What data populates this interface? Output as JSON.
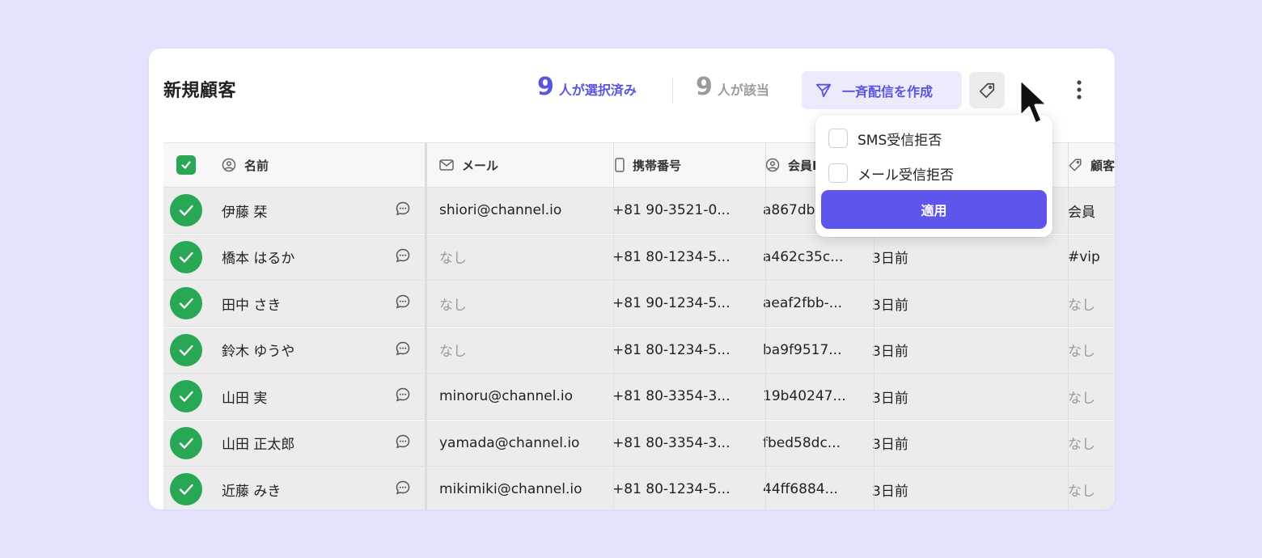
{
  "panel": {
    "title": "新規顧客",
    "selected_count": "9",
    "selected_label": "人が選択済み",
    "matched_count": "9",
    "matched_label": "人が該当",
    "broadcast_label": "一斉配信を作成"
  },
  "colors": {
    "accent": "#5e55ec",
    "check_green": "#28a754",
    "background": "#e3e3fd"
  },
  "columns": [
    "名前",
    "メール",
    "携帯番号",
    "会員I",
    "顧客"
  ],
  "rows": [
    {
      "name": "伊藤 栞",
      "email": "shiori@channel.io",
      "phone": "+81 90-3521-0...",
      "member_id": "a867db",
      "last": "",
      "tag": "会員"
    },
    {
      "name": "橋本 はるか",
      "email": "なし",
      "phone": "+81 80-1234-5...",
      "member_id": "a462c35c...",
      "last": "3日前",
      "tag": "#vip"
    },
    {
      "name": "田中 さき",
      "email": "なし",
      "phone": "+81 90-1234-5...",
      "member_id": "aeaf2fbb-...",
      "last": "3日前",
      "tag": "なし"
    },
    {
      "name": "鈴木 ゆうや",
      "email": "なし",
      "phone": "+81 80-1234-5...",
      "member_id": "ba9f9517...",
      "last": "3日前",
      "tag": "なし"
    },
    {
      "name": "山田 実",
      "email": "minoru@channel.io",
      "phone": "+81 80-3354-3...",
      "member_id": "19b40247...",
      "last": "3日前",
      "tag": "なし"
    },
    {
      "name": "山田 正太郎",
      "email": "yamada@channel.io",
      "phone": "+81 80-3354-3...",
      "member_id": "fbed58dc...",
      "last": "3日前",
      "tag": "なし"
    },
    {
      "name": "近藤 みき",
      "email": "mikimiki@channel.io",
      "phone": "+81 80-1234-5...",
      "member_id": "44ff6884...",
      "last": "3日前",
      "tag": "なし"
    }
  ],
  "dropdown": {
    "options": [
      "SMS受信拒否",
      "メール受信拒否"
    ],
    "apply_label": "適用"
  },
  "icons": {
    "broadcast": "send-icon",
    "tag": "tag-icon",
    "more": "more-vertical-icon",
    "chat": "chat-bubble-icon",
    "cursor": "mouse-pointer-icon"
  }
}
